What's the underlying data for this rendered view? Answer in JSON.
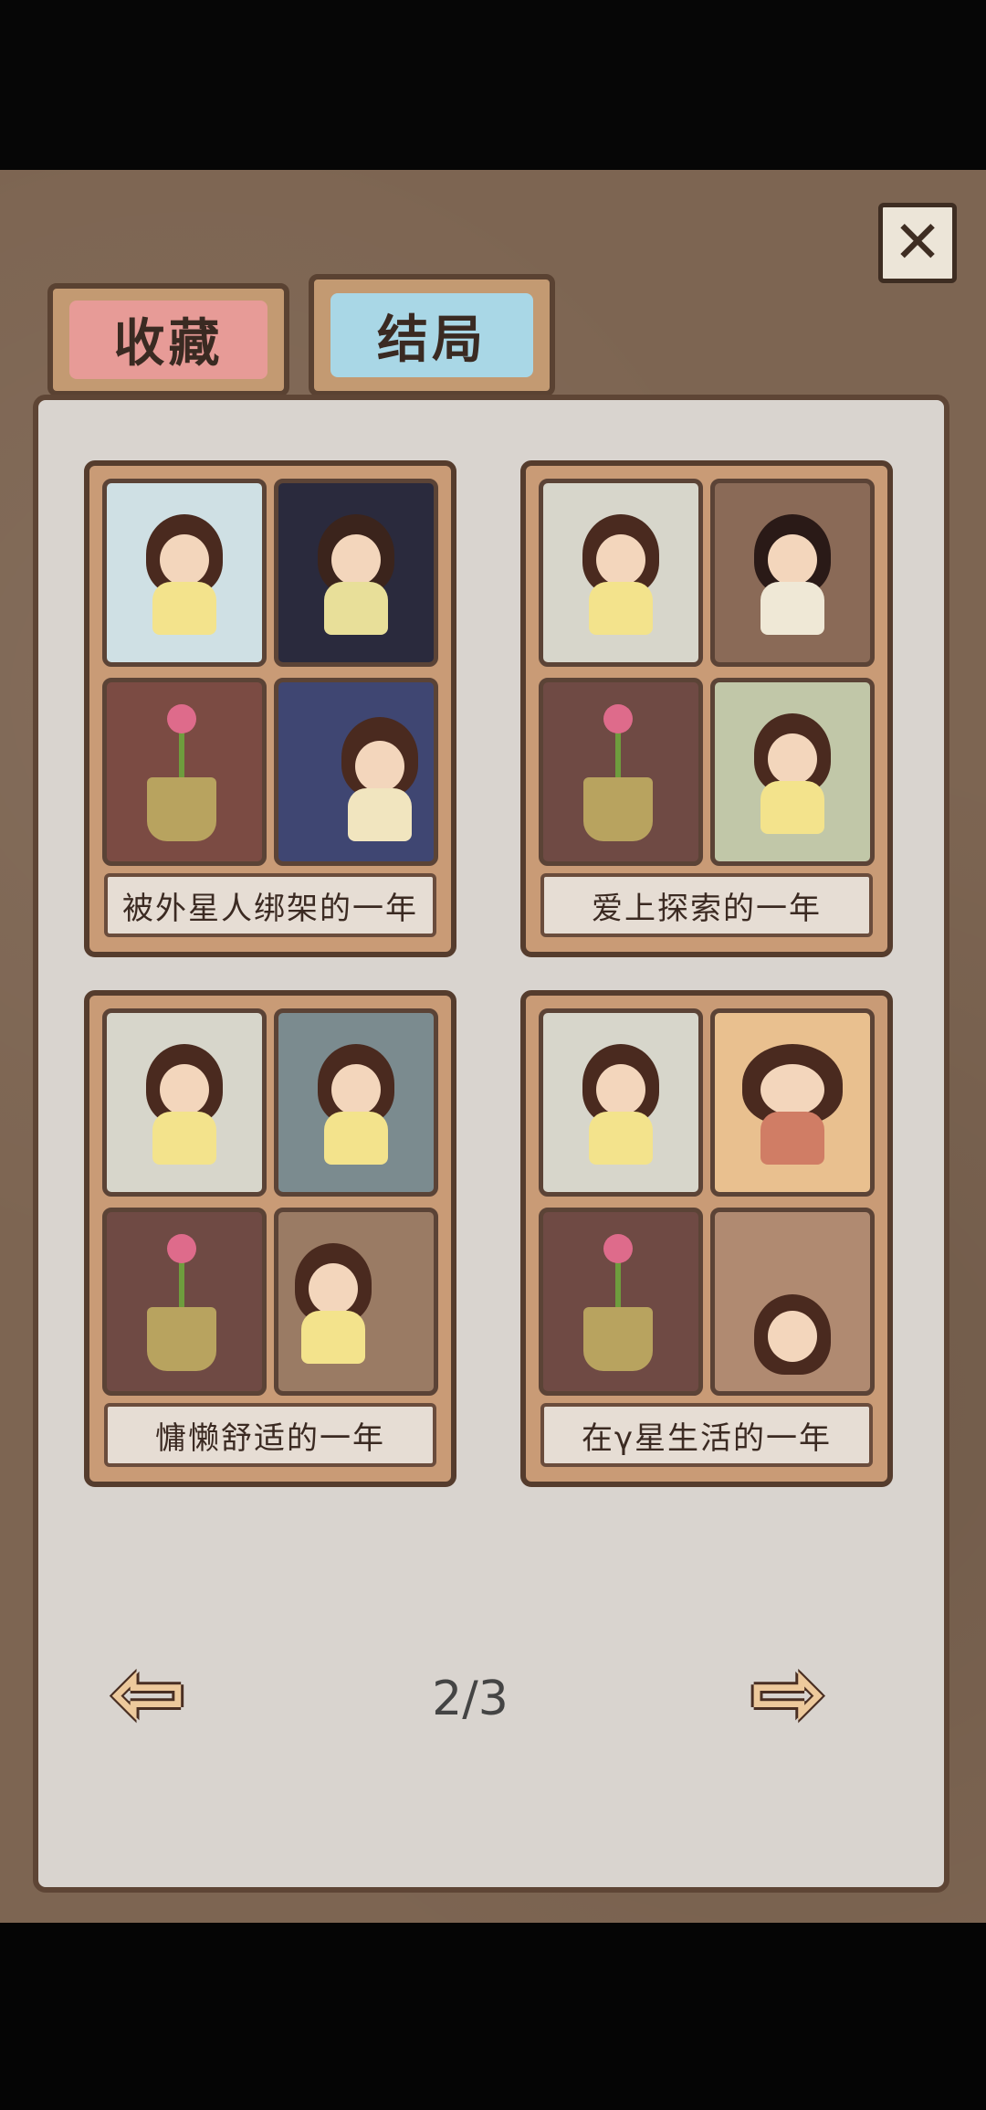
{
  "close": {
    "icon": "close-icon"
  },
  "tabs": [
    {
      "label": "收藏",
      "active": false,
      "color": "#e79b97"
    },
    {
      "label": "结局",
      "active": true,
      "color": "#a9d7e6"
    }
  ],
  "cards": [
    {
      "caption": "被外星人绑架的一年",
      "thumbs": [
        "yoga-girl",
        "guitar-girl",
        "flower-pot",
        "bar-girl"
      ]
    },
    {
      "caption": "爱上探索的一年",
      "thumbs": [
        "yoga-girl",
        "meditation-girl",
        "flower-pot",
        "plant-girl"
      ]
    },
    {
      "caption": "慵懒舒适的一年",
      "thumbs": [
        "yoga-girl",
        "headphone-girl",
        "flower-pot",
        "sofa-girl"
      ]
    },
    {
      "caption": "在γ星生活的一年",
      "thumbs": [
        "yoga-girl",
        "food-girl",
        "flower-pot",
        "floating-girl"
      ]
    }
  ],
  "pagination": {
    "current": "2/3"
  },
  "nav": {
    "prev_icon": "left-arrow-icon",
    "next_icon": "right-arrow-icon"
  }
}
